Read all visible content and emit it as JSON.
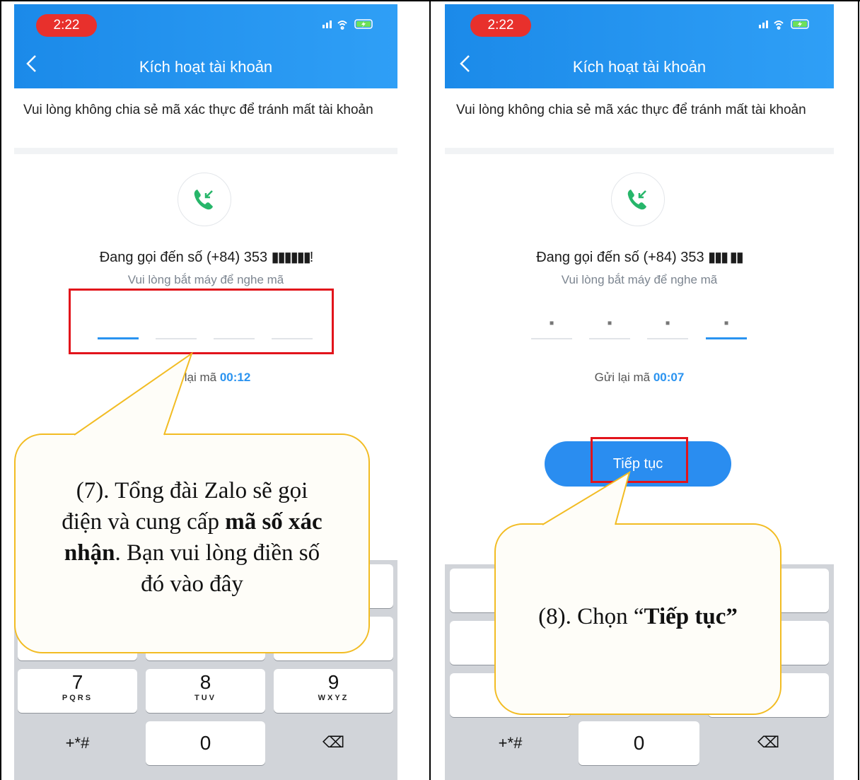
{
  "screens": [
    {
      "status": {
        "time": "2:22",
        "icons": "signal-wifi-battery"
      },
      "header": {
        "back_icon": "chevron-left-icon",
        "title": "Kích hoạt tài khoản"
      },
      "notice": "Vui lòng không chia sẻ mã xác thực để tránh mất tài khoản",
      "call": {
        "icon": "incoming-call-icon",
        "text": "Đang gọi đến số (+84) 353 ",
        "masked": "▮▮▮▮▮▮!",
        "hint": "Vui lòng bắt máy để nghe mã"
      },
      "otp": {
        "digits": [
          "",
          "",
          "",
          ""
        ],
        "active_index": 0
      },
      "resend": {
        "label": "Gửi lại mã",
        "timer": "00:12"
      },
      "keyboard": [
        {
          "num": "7",
          "letters": "PQRS"
        },
        {
          "num": "8",
          "letters": "TUV"
        },
        {
          "num": "9",
          "letters": "WXYZ"
        },
        {
          "num": "+*#",
          "letters": ""
        },
        {
          "num": "0",
          "letters": ""
        },
        {
          "num": "⌫",
          "letters": ""
        }
      ],
      "annotation": {
        "line1": "(7). Tổng đài Zalo sẽ gọi",
        "line2a": "điện và cung cấp ",
        "line2b": "mã số xác",
        "line3a": "nhận",
        "line3b": ". Bạn vui lòng điền số",
        "line4": "đó vào đây"
      }
    },
    {
      "status": {
        "time": "2:22",
        "icons": "signal-wifi-battery"
      },
      "header": {
        "back_icon": "chevron-left-icon",
        "title": "Kích hoạt tài khoản"
      },
      "notice": "Vui lòng không chia sẻ mã xác thực để tránh mất tài khoản",
      "call": {
        "icon": "incoming-call-icon",
        "text": "Đang gọi đến số (+84) 353 ",
        "masked": "▮▮▮ ▮▮",
        "hint": "Vui lòng bắt máy để nghe mã"
      },
      "otp": {
        "digits": [
          "▪",
          "▪",
          "▪",
          "▪"
        ],
        "active_index": 3
      },
      "resend": {
        "label": "Gửi lại mã",
        "timer": "00:07"
      },
      "continue_label": "Tiếp tục",
      "keyboard": [
        {
          "num": "+*#",
          "letters": ""
        },
        {
          "num": "0",
          "letters": ""
        },
        {
          "num": "⌫",
          "letters": ""
        }
      ],
      "annotation": {
        "line1a": "(8). Chọn “",
        "line1b": "Tiếp tục”"
      }
    }
  ]
}
